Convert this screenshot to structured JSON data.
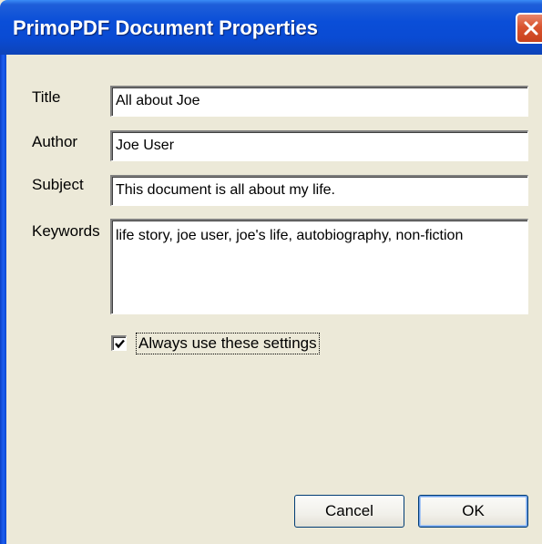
{
  "window": {
    "title": "PrimoPDF Document Properties",
    "close_icon": "close-icon"
  },
  "fields": {
    "title": {
      "label": "Title",
      "value": "All about Joe"
    },
    "author": {
      "label": "Author",
      "value": "Joe User"
    },
    "subject": {
      "label": "Subject",
      "value": "This document is all about my life."
    },
    "keywords": {
      "label": "Keywords",
      "value": "life story, joe user, joe's life, autobiography, non-fiction"
    }
  },
  "options": {
    "always_use_label": "Always use these settings",
    "always_use_checked": true
  },
  "buttons": {
    "cancel": "Cancel",
    "ok": "OK"
  },
  "colors": {
    "titlebar": "#0a4ed8",
    "dialog_bg": "#ece9d8",
    "close_button": "#d9542f"
  }
}
